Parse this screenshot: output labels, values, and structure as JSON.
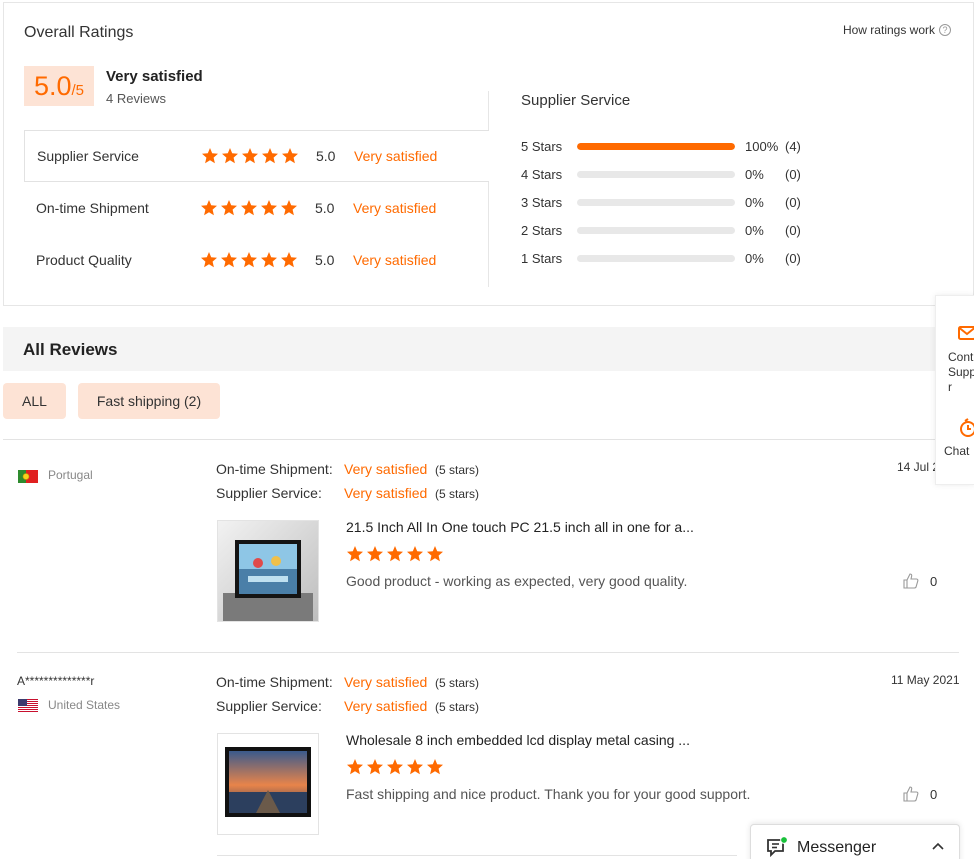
{
  "overall": {
    "title": "Overall Ratings",
    "how_link": "How ratings work",
    "score": "5.0",
    "score_max": "/5",
    "satisfaction": "Very satisfied",
    "review_count": "4 Reviews",
    "categories": [
      {
        "name": "Supplier Service",
        "score": "5.0",
        "label": "Very satisfied",
        "stars": 5
      },
      {
        "name": "On-time Shipment",
        "score": "5.0",
        "label": "Very satisfied",
        "stars": 5
      },
      {
        "name": "Product Quality",
        "score": "5.0",
        "label": "Very satisfied",
        "stars": 5
      }
    ]
  },
  "distribution": {
    "title": "Supplier Service",
    "rows": [
      {
        "label": "5  Stars",
        "fraction": 1.0,
        "pct": "100%",
        "count": "(4)"
      },
      {
        "label": "4  Stars",
        "fraction": 0.0,
        "pct": "0%",
        "count": "(0)"
      },
      {
        "label": "3  Stars",
        "fraction": 0.0,
        "pct": "0%",
        "count": "(0)"
      },
      {
        "label": "2  Stars",
        "fraction": 0.0,
        "pct": "0%",
        "count": "(0)"
      },
      {
        "label": "1  Stars",
        "fraction": 0.0,
        "pct": "0%",
        "count": "(0)"
      }
    ]
  },
  "all_reviews": {
    "title": "All Reviews",
    "filters": [
      "ALL",
      "Fast shipping (2)"
    ]
  },
  "reviews": [
    {
      "reviewer": "",
      "country": "Portugal",
      "shipment_label": "On-time Shipment:",
      "shipment_value": "Very satisfied",
      "shipment_stars": "(5 stars)",
      "service_label": "Supplier Service:",
      "service_value": "Very satisfied",
      "service_stars": "(5 stars)",
      "date": "14 Jul 2",
      "product_title": "21.5 Inch All In One touch PC 21.5 inch all in one for a...",
      "rating": 5,
      "text": "Good product - working as expected, very good quality.",
      "likes": "0"
    },
    {
      "reviewer": "A**************r",
      "country": "United States",
      "shipment_label": "On-time Shipment:",
      "shipment_value": "Very satisfied",
      "shipment_stars": "(5 stars)",
      "service_label": "Supplier Service:",
      "service_value": "Very satisfied",
      "service_stars": "(5 stars)",
      "date": "11 May 2021",
      "product_title": "Wholesale 8 inch embedded lcd display metal casing ...",
      "rating": 5,
      "text": "Fast shipping and nice product. Thank you for your good support.",
      "likes": "0"
    }
  ],
  "side": {
    "contact_label": "Cont\nSupp\nr",
    "chat_label": "Chat"
  },
  "messenger": {
    "label": "Messenger"
  },
  "colors": {
    "accent": "#ff6a00",
    "accent_bg": "#fde3d5",
    "online": "#19c13a"
  },
  "icons": [
    "question-icon",
    "star-icon",
    "flag-portugal-icon",
    "flag-us-icon",
    "thumbs-up-icon",
    "mail-icon",
    "chat-icon",
    "messenger-icon",
    "chevron-up-icon"
  ]
}
